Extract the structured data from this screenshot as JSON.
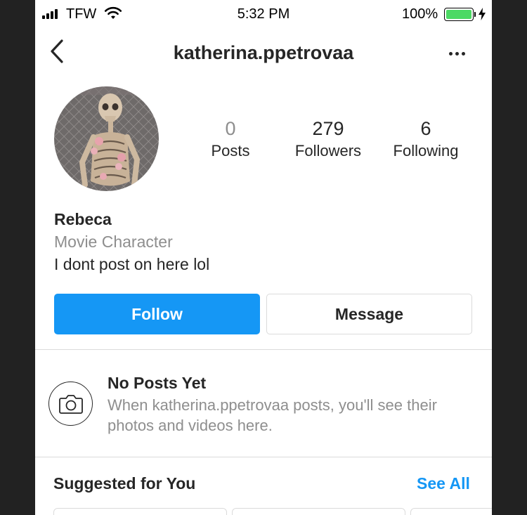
{
  "status_bar": {
    "carrier": "TFW",
    "time": "5:32 PM",
    "battery_percent": "100%",
    "battery_level": 1.0,
    "battery_color": "#4cd964"
  },
  "header": {
    "username": "katherina.ppetrovaa",
    "back_icon": "chevron-left-icon",
    "more_icon": "more-horizontal-icon"
  },
  "profile": {
    "avatar_icon": "skeleton-photo",
    "stats": [
      {
        "count": "0",
        "label": "Posts"
      },
      {
        "count": "279",
        "label": "Followers"
      },
      {
        "count": "6",
        "label": "Following"
      }
    ],
    "name": "Rebeca",
    "category": "Movie Character",
    "bio": "I dont post on here lol"
  },
  "actions": {
    "follow_label": "Follow",
    "message_label": "Message",
    "accent_color": "#1597f5"
  },
  "empty_state": {
    "icon": "camera-icon",
    "title": "No Posts Yet",
    "description": "When katherina.ppetrovaa posts, you'll see their photos and videos here."
  },
  "suggested": {
    "title": "Suggested for You",
    "see_all_label": "See All"
  }
}
